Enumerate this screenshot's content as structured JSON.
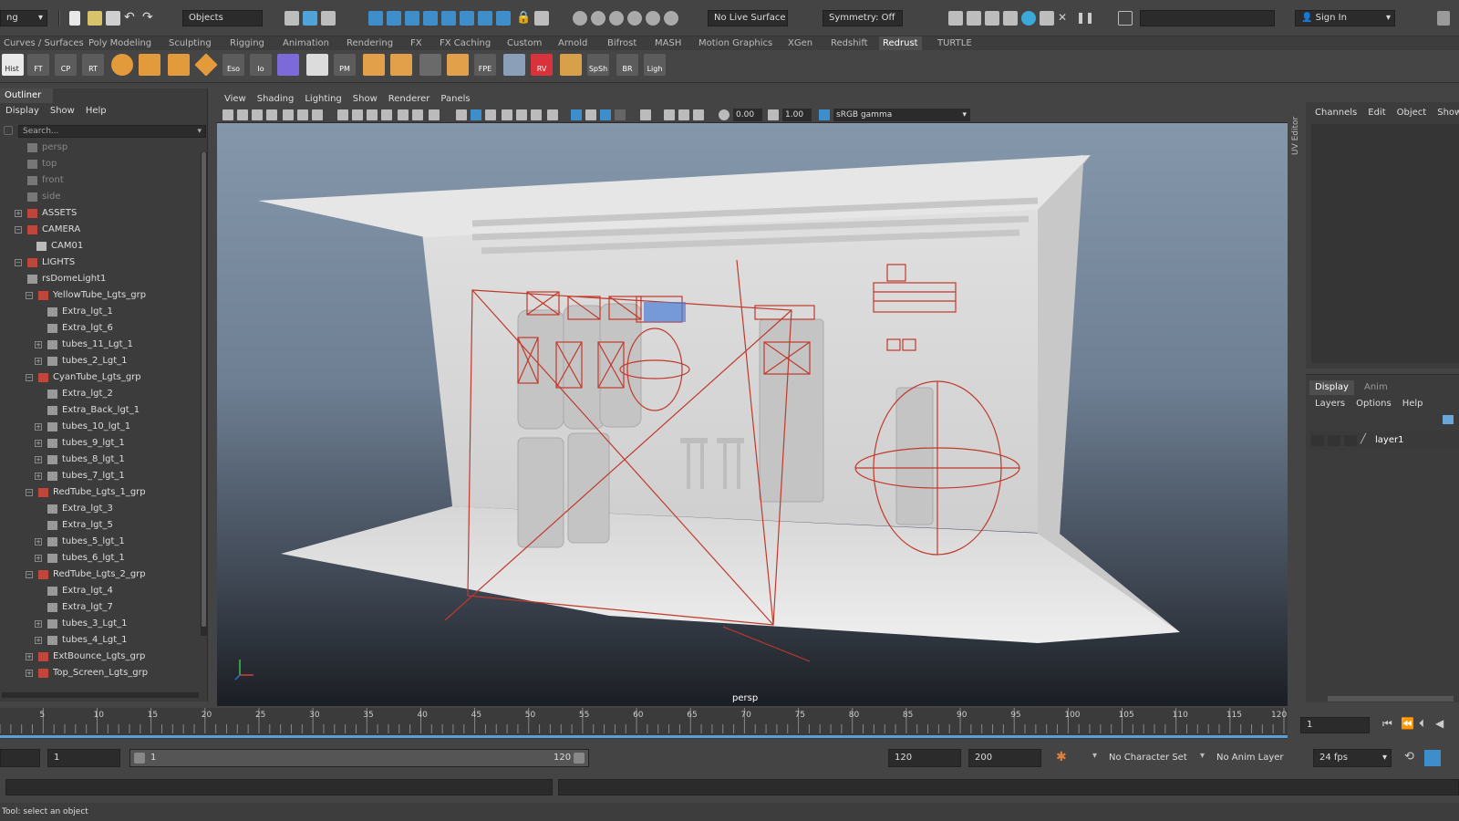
{
  "statusline": {
    "menuset": "ng",
    "selection_mode": "Objects",
    "live_surface": "No Live Surface",
    "symmetry": "Symmetry: Off",
    "sign_in": "Sign In"
  },
  "shelf_tabs": [
    "Curves / Surfaces",
    "Poly Modeling",
    "Sculpting",
    "Rigging",
    "Animation",
    "Rendering",
    "FX",
    "FX Caching",
    "Custom",
    "Arnold",
    "Bifrost",
    "MASH",
    "Motion Graphics",
    "XGen",
    "Redshift",
    "Redrust",
    "TURTLE"
  ],
  "shelf_active": "Redrust",
  "shelf_labels": [
    "Hist",
    "FT",
    "CP",
    "RT",
    "Eso",
    "Io",
    "PM",
    "FPE",
    "RV",
    "SpSh",
    "BR",
    "Ligh"
  ],
  "outliner": {
    "title": "Outliner",
    "menu": [
      "Display",
      "Show",
      "Help"
    ],
    "search_placeholder": "Search...",
    "items": [
      {
        "label": "persp",
        "dim": true
      },
      {
        "label": "top",
        "dim": true
      },
      {
        "label": "front",
        "dim": true
      },
      {
        "label": "side",
        "dim": true
      },
      {
        "label": "ASSETS"
      },
      {
        "label": "CAMERA"
      },
      {
        "label": "CAM01"
      },
      {
        "label": "LIGHTS"
      },
      {
        "label": "rsDomeLight1"
      },
      {
        "label": "YellowTube_Lgts_grp"
      },
      {
        "label": "Extra_lgt_1"
      },
      {
        "label": "Extra_lgt_6"
      },
      {
        "label": "tubes_11_Lgt_1"
      },
      {
        "label": "tubes_2_Lgt_1"
      },
      {
        "label": "CyanTube_Lgts_grp"
      },
      {
        "label": "Extra_lgt_2"
      },
      {
        "label": "Extra_Back_lgt_1"
      },
      {
        "label": "tubes_10_lgt_1"
      },
      {
        "label": "tubes_9_lgt_1"
      },
      {
        "label": "tubes_8_lgt_1"
      },
      {
        "label": "tubes_7_lgt_1"
      },
      {
        "label": "RedTube_Lgts_1_grp"
      },
      {
        "label": "Extra_lgt_3"
      },
      {
        "label": "Extra_lgt_5"
      },
      {
        "label": "tubes_5_lgt_1"
      },
      {
        "label": "tubes_6_lgt_1"
      },
      {
        "label": "RedTube_Lgts_2_grp"
      },
      {
        "label": "Extra_lgt_4"
      },
      {
        "label": "Extra_lgt_7"
      },
      {
        "label": "tubes_3_Lgt_1"
      },
      {
        "label": "tubes_4_Lgt_1"
      },
      {
        "label": "ExtBounce_Lgts_grp"
      },
      {
        "label": "Top_Screen_Lgts_grp"
      }
    ]
  },
  "viewport": {
    "menu": [
      "View",
      "Shading",
      "Lighting",
      "Show",
      "Renderer",
      "Panels"
    ],
    "exposure": "0.00",
    "gamma": "1.00",
    "color_space": "sRGB gamma",
    "camera": "persp"
  },
  "side_tab": "UV Editor",
  "channelbox": {
    "menu": [
      "Channels",
      "Edit",
      "Object",
      "Show"
    ]
  },
  "layer_editor": {
    "tabs": [
      "Display",
      "Anim"
    ],
    "menu": [
      "Layers",
      "Options",
      "Help"
    ],
    "layer": "layer1"
  },
  "timeline": {
    "ticks": [
      5,
      10,
      15,
      20,
      25,
      30,
      35,
      40,
      45,
      50,
      55,
      60,
      65,
      70,
      75,
      80,
      85,
      90,
      95,
      100,
      105,
      110,
      115,
      120
    ],
    "current_frame": "1"
  },
  "range": {
    "start": "1",
    "slider_start": "1",
    "slider_end": "120",
    "end": "120",
    "anim_end": "200",
    "character_set": "No Character Set",
    "anim_layer": "No Anim Layer",
    "fps": "24 fps"
  },
  "helpline": "Tool: select an object",
  "colors": {
    "accent": "#5aa0d8",
    "light_wire": "#c0392b"
  }
}
